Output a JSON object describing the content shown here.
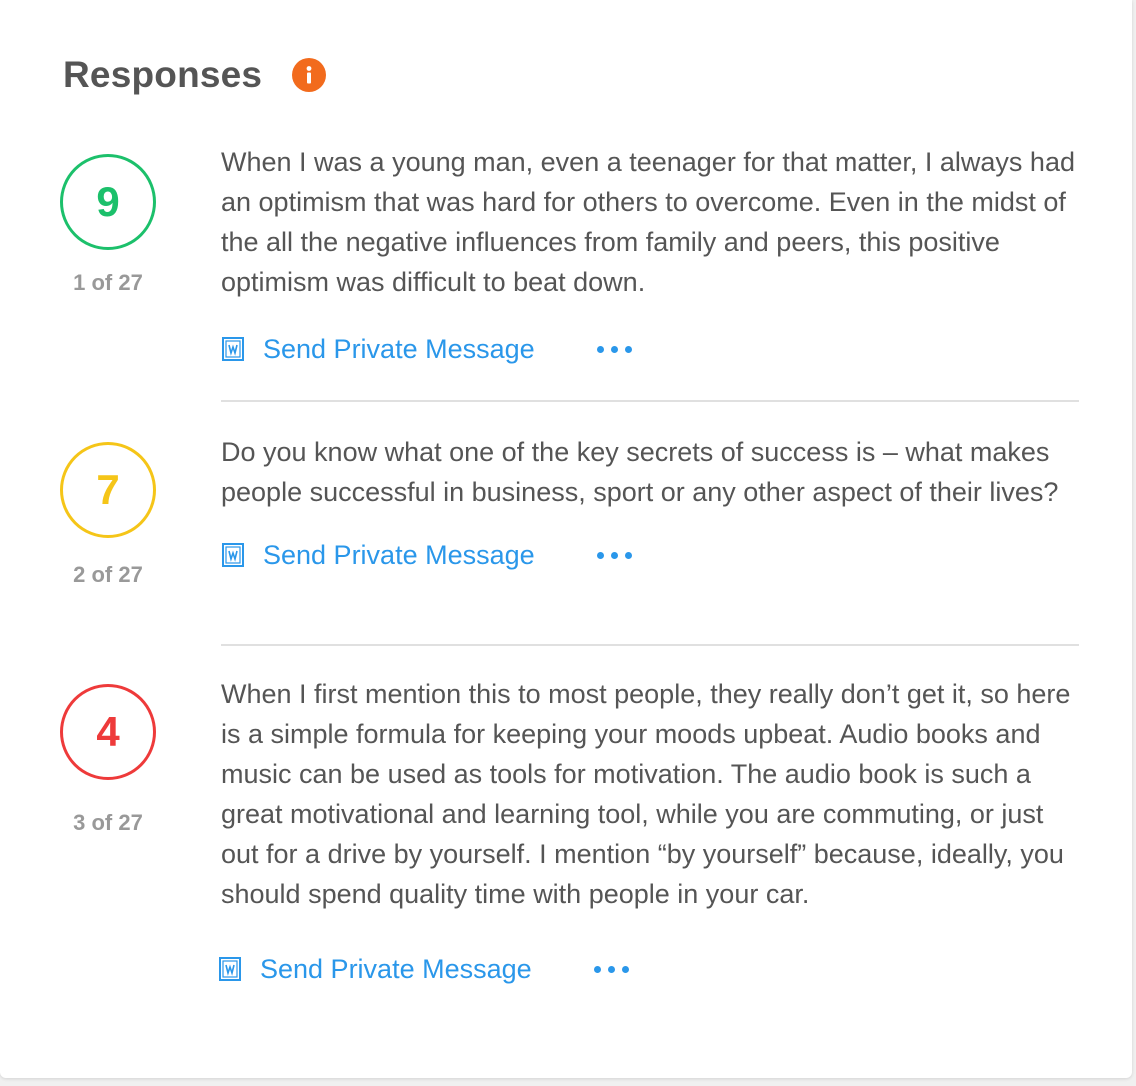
{
  "header": {
    "title": "Responses",
    "info_icon": "info-icon"
  },
  "colors": {
    "green": "#1cc06b",
    "yellow": "#f5c518",
    "red": "#ee3a3a",
    "link": "#2a97ea",
    "info": "#f26b1d"
  },
  "responses": [
    {
      "score": "9",
      "rank": "1 of 27",
      "text": "When I was a young man, even a teenager for that matter, I always had an optimism that was hard for others to overcome. Even in the midst of the all the negative influences from family and peers, this positive optimism was difficult to beat down.",
      "action_label": "Send Private Message",
      "more_label": "more-options-icon"
    },
    {
      "score": "7",
      "rank": "2 of 27",
      "text": "Do you know what one of the key secrets of success is – what makes people successful in business, sport or any other aspect of their lives?",
      "action_label": "Send Private Message",
      "more_label": "more-options-icon"
    },
    {
      "score": "4",
      "rank": "3 of 27",
      "text": "When I first mention this to most people, they really don’t get it, so here is a simple formula for keeping your moods upbeat. Audio books and music can be used as tools for motivation. The audio book is such a great motivational and learning tool, while you are commuting, or just out for a drive by yourself. I mention “by yourself” because, ideally, you should spend quality time with people in your car.",
      "action_label": "Send Private Message",
      "more_label": "more-options-icon"
    }
  ]
}
